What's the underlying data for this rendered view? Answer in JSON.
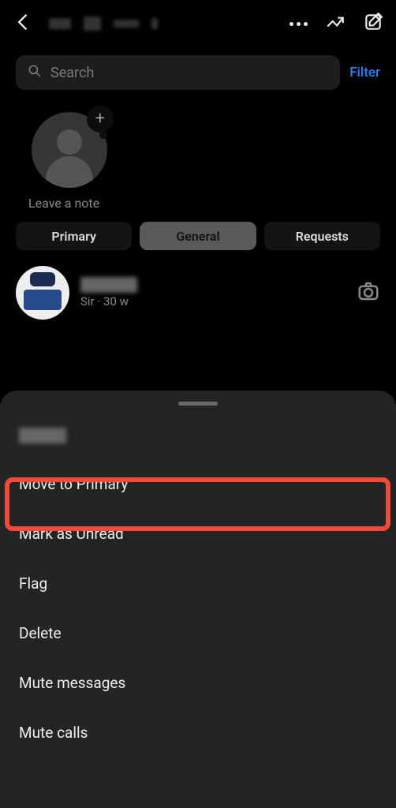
{
  "search": {
    "placeholder": "Search"
  },
  "filter_label": "Filter",
  "note_label": "Leave a note",
  "tabs": {
    "primary": "Primary",
    "general": "General",
    "requests": "Requests"
  },
  "chat": {
    "name_redacted": "██████",
    "sub_prefix": "Sir",
    "sub_sep": " · ",
    "sub_time": "30 w"
  },
  "sheet": {
    "header_redacted": "█████",
    "move_to_primary": "Move to Primary",
    "mark_as_unread": "Mark as Unread",
    "flag": "Flag",
    "delete": "Delete",
    "mute_messages": "Mute messages",
    "mute_calls": "Mute calls"
  }
}
